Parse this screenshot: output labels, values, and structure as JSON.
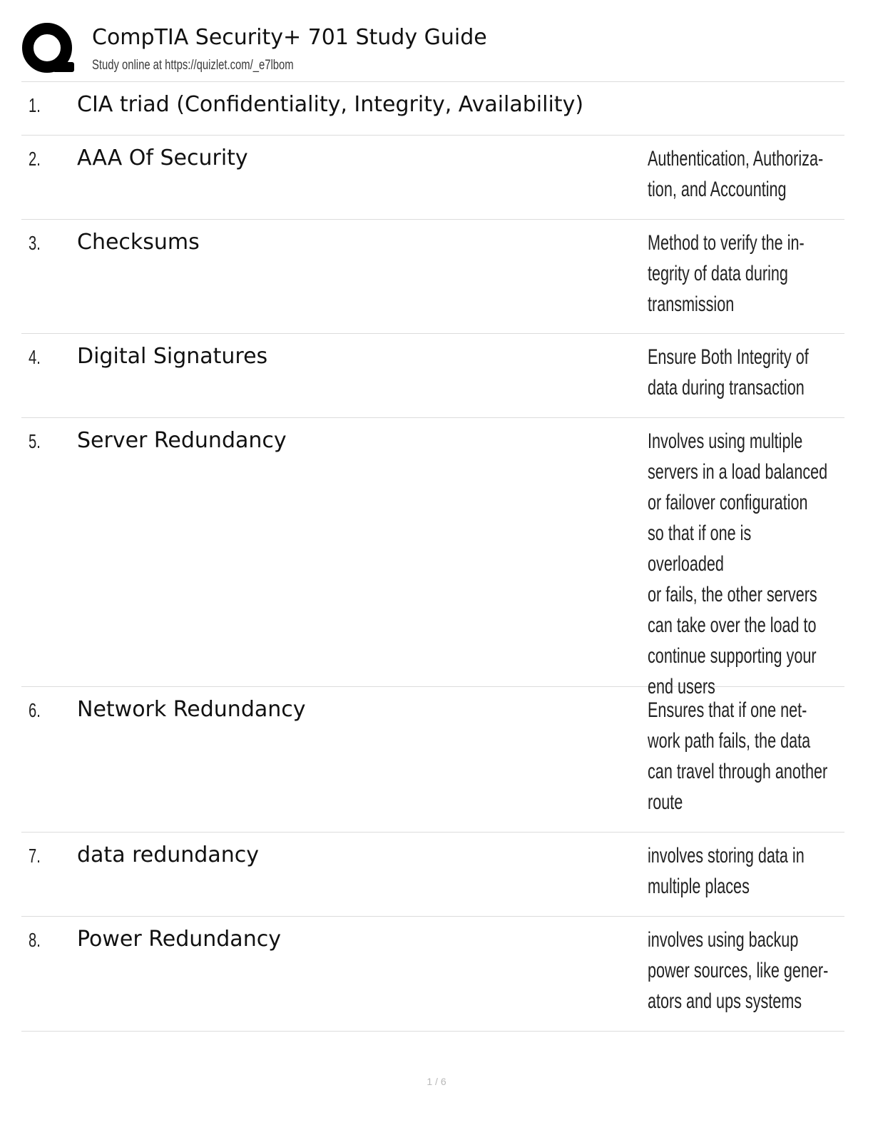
{
  "header": {
    "logo_icon": "quizlet-q-logo-icon",
    "title": "CompTIA Security+ 701 Study Guide",
    "subtitle": "Study online at https://quizlet.com/_e7lbom"
  },
  "entries": [
    {
      "number": "1.",
      "term": "CIA triad (Confidentiality, Integrity, Availability)",
      "definition": ""
    },
    {
      "number": "2.",
      "term": "AAA Of Security",
      "definition": "Authentication, Authoriza-\ntion, and Accounting"
    },
    {
      "number": "3.",
      "term": "Checksums",
      "definition": "Method to verify the in-\ntegrity of data during\ntransmission"
    },
    {
      "number": "4.",
      "term": "Digital Signatures",
      "definition": "Ensure Both Integrity of\ndata during transaction"
    },
    {
      "number": "5.",
      "term": "Server Redundancy",
      "definition": "Involves using multiple\nservers in a load balanced\nor failover configuration\nso that if one is overloaded\nor fails, the other servers\ncan take over the load to\ncontinue supporting your\nend users"
    },
    {
      "number": "6.",
      "term": "Network Redundancy",
      "definition": "Ensures that if one net-\nwork path fails, the data\ncan travel through another\nroute"
    },
    {
      "number": "7.",
      "term": "data redundancy",
      "definition": "involves storing data in\nmultiple places"
    },
    {
      "number": "8.",
      "term": "Power Redundancy",
      "definition": "involves using backup\npower sources, like gener-\nators and ups systems"
    }
  ],
  "footer": {
    "page": "1 / 6"
  }
}
